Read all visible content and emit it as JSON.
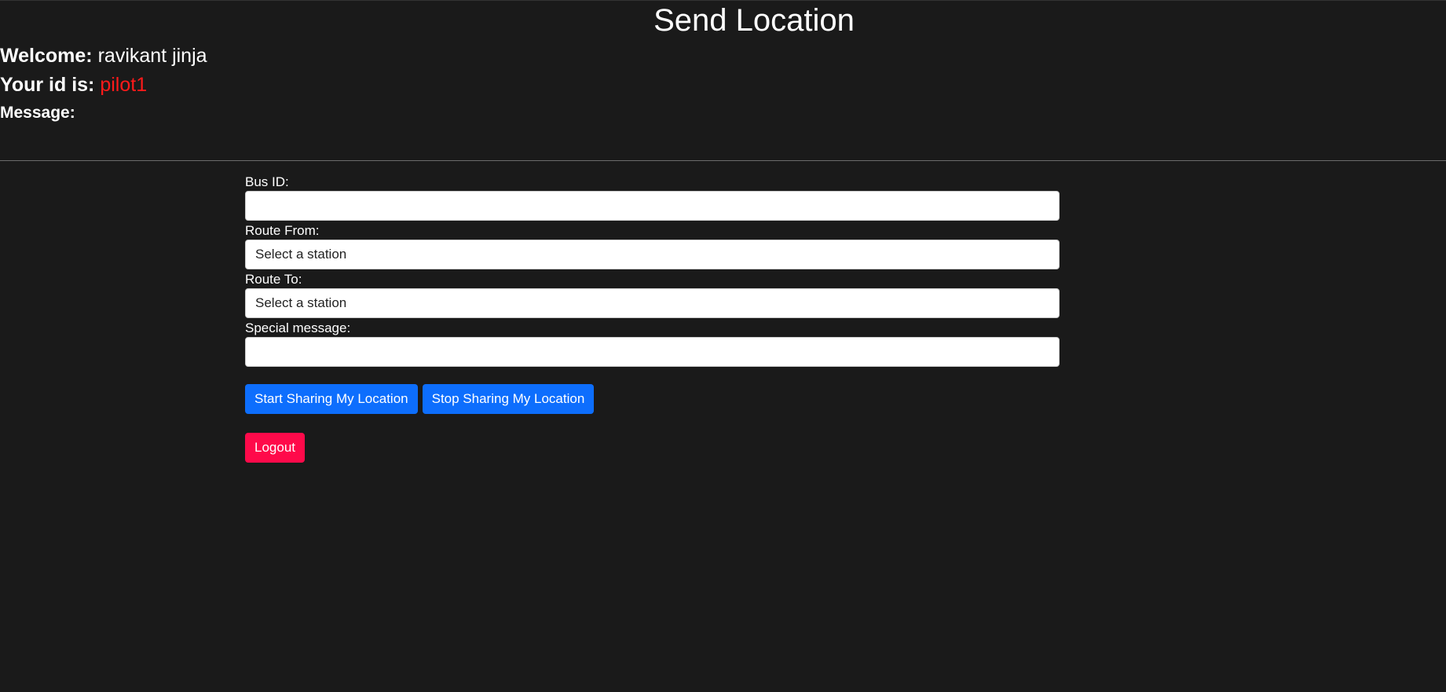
{
  "header": {
    "title": "Send Location",
    "welcome_label": "Welcome:",
    "welcome_name": "ravikant jinja",
    "id_label": "Your id is:",
    "id_value": "pilot1",
    "message_label": "Message:"
  },
  "form": {
    "bus_id_label": "Bus ID:",
    "bus_id_value": "",
    "route_from_label": "Route From:",
    "route_from_selected": "Select a station",
    "route_to_label": "Route To:",
    "route_to_selected": "Select a station",
    "special_message_label": "Special message:",
    "special_message_value": ""
  },
  "buttons": {
    "start_label": "Start Sharing My Location",
    "stop_label": "Stop Sharing My Location",
    "logout_label": "Logout"
  },
  "colors": {
    "background": "#1a1a1a",
    "id_value": "#ff1a1a",
    "primary_button": "#0d6efd",
    "logout_button": "#ff0a4a"
  }
}
